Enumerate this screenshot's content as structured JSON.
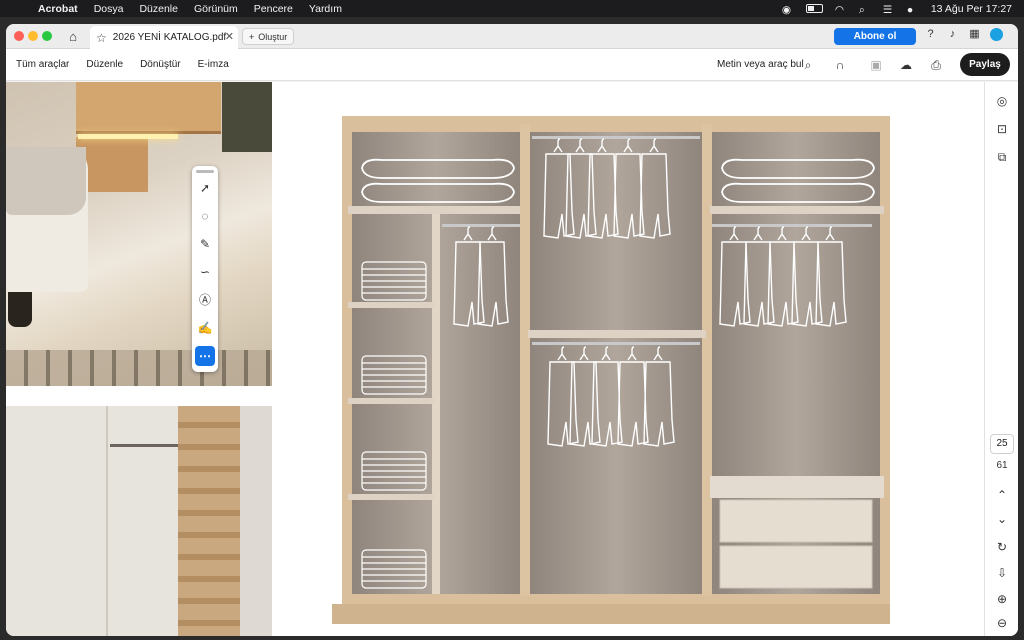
{
  "menubar": {
    "app_name": "Acrobat",
    "menus": [
      "Dosya",
      "Düzenle",
      "Görünüm",
      "Pencere",
      "Yardım"
    ],
    "date_time": "13 Ağu Per  17:27"
  },
  "tabs": {
    "document_title": "2026 YENİ KATALOG.pdf",
    "new_tab_label": "Oluştur",
    "subscribe_label": "Abone ol"
  },
  "toolbar": {
    "items": [
      "Tüm araçlar",
      "Düzenle",
      "Dönüştür",
      "E-imza"
    ],
    "search_label": "Metin veya araç bul",
    "share_label": "Paylaş"
  },
  "quick_tools": [
    "select-icon",
    "comment-icon",
    "highlight-icon",
    "draw-icon",
    "text-select-icon",
    "sign-icon",
    "more-icon"
  ],
  "page_nav": {
    "current_page": "25",
    "total_pages": "61"
  },
  "colors": {
    "accent": "#1473e6",
    "wood": "#d9bf9b",
    "wardrobe_back": "#a89d93"
  }
}
